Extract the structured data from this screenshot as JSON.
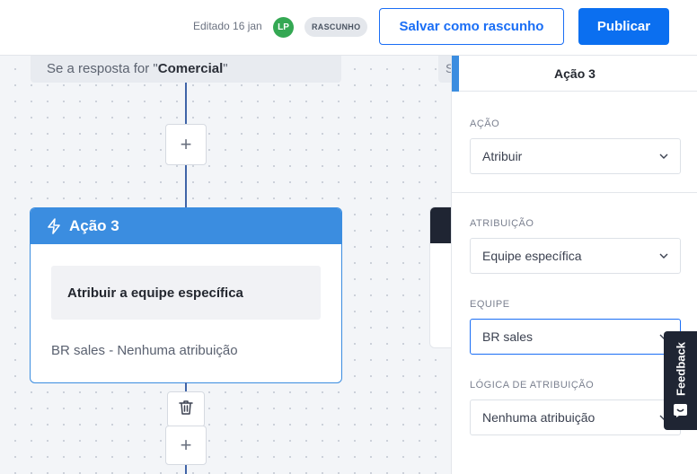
{
  "header": {
    "edited_text": "Editado 16 jan",
    "avatar_initials": "LP",
    "status_badge": "RASCUNHO",
    "save_draft_label": "Salvar como rascunho",
    "publish_label": "Publicar"
  },
  "canvas": {
    "previous_node": {
      "prefix": "Se a resposta for \"",
      "value": "Comercial",
      "suffix": "\""
    },
    "right_node_fragment": "S",
    "add_step_symbol": "+",
    "action_node": {
      "title": "Ação 3",
      "summary": "Atribuir a equipe específica",
      "detail": "BR sales - Nenhuma atribuição",
      "icon": "bolt-icon"
    }
  },
  "panel": {
    "title": "Ação 3",
    "fields": [
      {
        "label": "AÇÃO",
        "value": "Atribuir"
      },
      {
        "label": "ATRIBUIÇÃO",
        "value": "Equipe específica"
      },
      {
        "label": "EQUIPE",
        "value": "BR sales"
      },
      {
        "label": "LÓGICA DE ATRIBUIÇÃO",
        "value": "Nenhuma atribuição"
      }
    ]
  },
  "feedback_label": "Feedback",
  "colors": {
    "primary": "#0b6ff0",
    "node_header": "#3b8de0",
    "connector": "#3f64a8",
    "avatar": "#34a853",
    "feedback_bg": "#1f2533"
  }
}
